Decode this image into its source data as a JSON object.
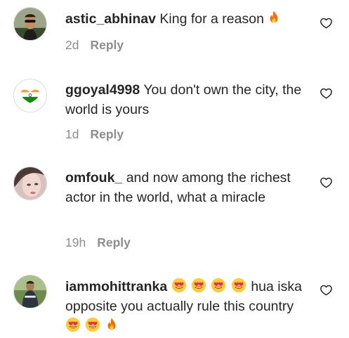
{
  "comments": [
    {
      "username": "astic_abhinav",
      "text": "King for a reason",
      "time": "2d",
      "reply_label": "Reply",
      "avatar_icon": "profile-photo-dark-jacket",
      "like_icon": "heart-outline-icon"
    },
    {
      "username": "ggoyal4998",
      "text": "You don't own the city, the world is yours",
      "time": "1d",
      "reply_label": "Reply",
      "avatar_icon": "india-flag-heart",
      "like_icon": "heart-outline-icon"
    },
    {
      "username": "omfouk_",
      "text": "and now among the richest actor in the world, what a miracle",
      "time": "19h",
      "reply_label": "Reply",
      "avatar_icon": "profile-photo-face",
      "like_icon": "heart-outline-icon"
    },
    {
      "username": "iammohittranka",
      "text_part1": "hua iska opposite you actually rule this country",
      "time": "",
      "reply_label": "",
      "avatar_icon": "profile-photo-outdoor",
      "like_icon": "heart-outline-icon"
    }
  ],
  "colors": {
    "text": "#262626",
    "meta": "#8e8e8e",
    "fire": "#ff6a00",
    "heart_eyes_face": "#ffcc33"
  }
}
